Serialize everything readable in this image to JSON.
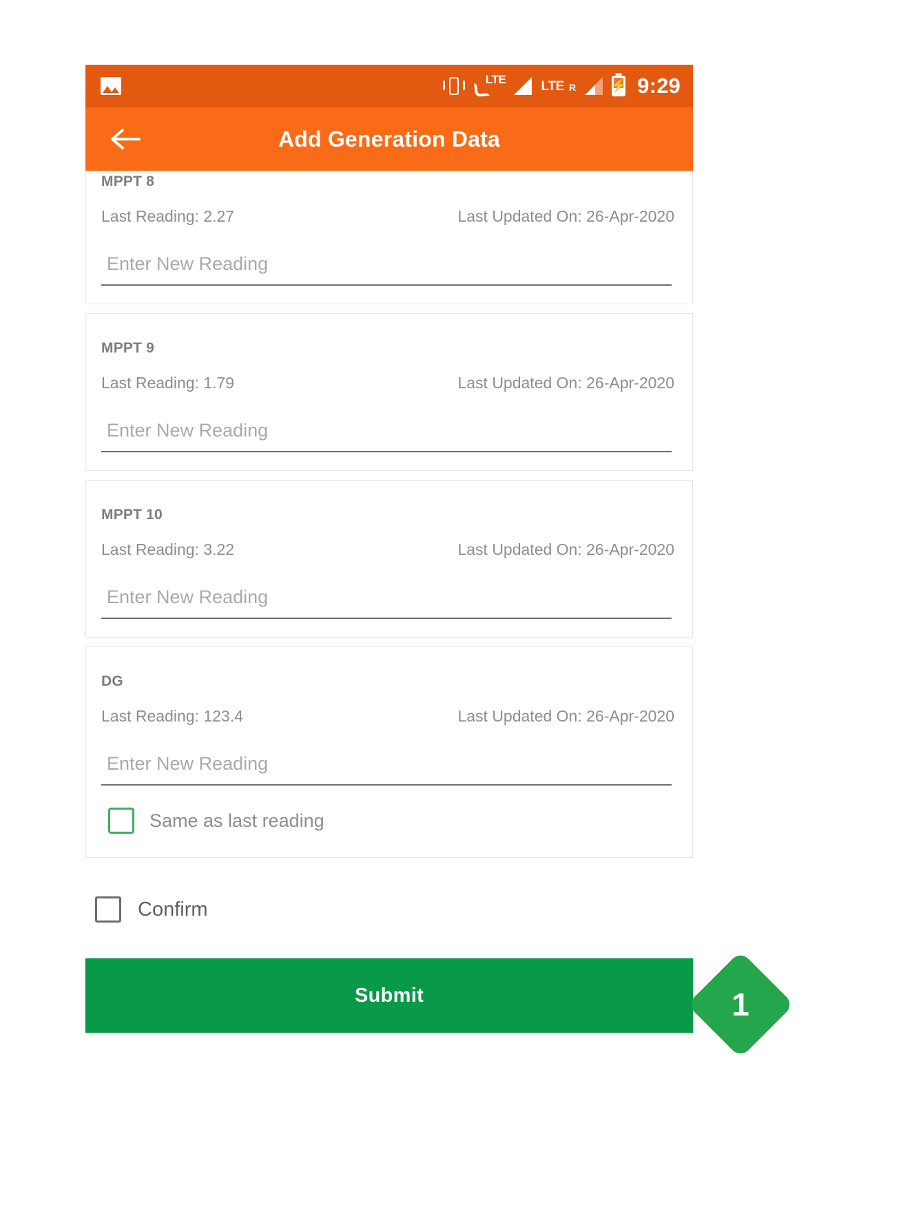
{
  "status_bar": {
    "background": "#e2590f",
    "icons": [
      "gallery-icon",
      "vibrate-icon",
      "call-lte-icon",
      "signal-full-icon",
      "signal-partial-icon",
      "battery-charging-icon"
    ],
    "lte_badge": "LTE",
    "network_label": "LTE",
    "roaming_label": "R",
    "clock": "9:29"
  },
  "app_bar": {
    "background": "#f96b16",
    "back_icon": "arrow-left-icon",
    "title": "Add Generation Data"
  },
  "cards": [
    {
      "title": "MPPT 8",
      "last_reading_label": "Last Reading: 2.27",
      "last_updated_label": "Last Updated On: 26-Apr-2020",
      "input_placeholder": "Enter New Reading",
      "input_value": "",
      "has_same_as_last": false
    },
    {
      "title": "MPPT 9",
      "last_reading_label": "Last Reading: 1.79",
      "last_updated_label": "Last Updated On: 26-Apr-2020",
      "input_placeholder": "Enter New Reading",
      "input_value": "",
      "has_same_as_last": false
    },
    {
      "title": "MPPT 10",
      "last_reading_label": "Last Reading: 3.22",
      "last_updated_label": "Last Updated On: 26-Apr-2020",
      "input_placeholder": "Enter New Reading",
      "input_value": "",
      "has_same_as_last": false
    },
    {
      "title": "DG",
      "last_reading_label": "Last Reading: 123.4",
      "last_updated_label": "Last Updated On: 26-Apr-2020",
      "input_placeholder": "Enter New Reading",
      "input_value": "",
      "has_same_as_last": true,
      "same_as_last_label": "Same as last reading",
      "same_as_last_checked": false,
      "same_as_last_border_color": "#3fae5f"
    }
  ],
  "confirm": {
    "label": "Confirm",
    "checked": false,
    "border_color": "#6d6d6d"
  },
  "submit": {
    "label": "Submit",
    "color": "#089949"
  },
  "step_badge": {
    "number": "1",
    "color": "#24a64d"
  }
}
